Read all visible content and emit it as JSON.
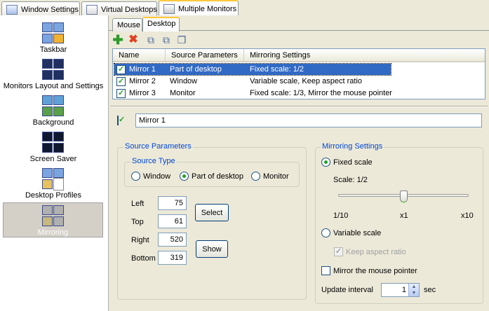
{
  "top_tabs": [
    {
      "label": "Window Settings",
      "icon": "window-settings-icon"
    },
    {
      "label": "Virtual Desktops",
      "icon": "virtual-desktops-icon"
    },
    {
      "label": "Multiple Monitors",
      "icon": "multiple-monitors-icon"
    }
  ],
  "sidebar": {
    "items": [
      {
        "label": "Taskbar"
      },
      {
        "label": "Monitors Layout and Settings"
      },
      {
        "label": "Background"
      },
      {
        "label": "Screen Saver"
      },
      {
        "label": "Desktop Profiles"
      },
      {
        "label": "Mirroring"
      }
    ]
  },
  "sub_tabs": [
    {
      "label": "Mouse"
    },
    {
      "label": "Desktop"
    }
  ],
  "list": {
    "columns": [
      "Name",
      "Source Parameters",
      "Mirroring Settings"
    ],
    "rows": [
      {
        "name": "Mirror 1",
        "source": "Part of desktop",
        "mirroring": "Fixed scale: 1/2"
      },
      {
        "name": "Mirror 2",
        "source": "Window",
        "mirroring": "Variable scale, Keep aspect ratio"
      },
      {
        "name": "Mirror 3",
        "source": "Monitor",
        "mirroring": "Fixed scale: 1/3, Mirror the mouse pointer"
      }
    ]
  },
  "name_field": {
    "value": "Mirror 1"
  },
  "source": {
    "title": "Source Parameters",
    "type_title": "Source Type",
    "options": [
      "Window",
      "Part of desktop",
      "Monitor"
    ],
    "selected": "Part of desktop",
    "left_label": "Left",
    "left": "75",
    "top_label": "Top",
    "top": "61",
    "right_label": "Right",
    "right": "520",
    "bottom_label": "Bottom",
    "bottom": "319",
    "select_label": "Select",
    "show_label": "Show"
  },
  "mirroring": {
    "title": "Mirroring Settings",
    "fixed_label": "Fixed scale",
    "scale_text": "Scale:  1/2",
    "scale_value": 0.5,
    "tick_min": "1/10",
    "tick_mid": "x1",
    "tick_max": "x10",
    "variable_label": "Variable scale",
    "keep_aspect_label": "Keep aspect ratio",
    "mouse_pointer_label": "Mirror the mouse pointer",
    "update_label": "Update interval",
    "update_value": "1",
    "update_unit": "sec"
  }
}
